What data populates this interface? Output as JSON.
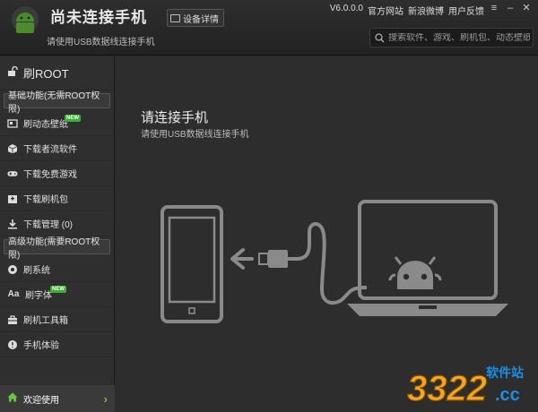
{
  "header": {
    "app_title": "尚未连接手机",
    "app_subtitle": "请使用USB数据线连接手机",
    "device_button": "设备详情",
    "version": "V6.0.0.0",
    "links": [
      "官方网站",
      "新浪微博",
      "用户反馈"
    ],
    "search_placeholder": "搜索软件、游戏、刷机包、动态壁纸"
  },
  "sidebar": {
    "root_label": "刷ROOT",
    "basic_section": "基础功能(无需ROOT权限)",
    "basic_items": [
      {
        "label": "刷动态壁纸",
        "new": "NEW",
        "icon": "wallpaper-icon"
      },
      {
        "label": "下载者流软件",
        "icon": "box-icon"
      },
      {
        "label": "下载免费游戏",
        "icon": "gamepad-icon"
      },
      {
        "label": "下载刷机包",
        "icon": "package-icon"
      },
      {
        "label": "下载管理 (0)",
        "icon": "download-icon"
      }
    ],
    "advanced_section": "高级功能(需要ROOT权限)",
    "advanced_items": [
      {
        "label": "刷系统",
        "icon": "system-icon"
      },
      {
        "label": "刷字体",
        "new": "NEW",
        "icon": "font-icon"
      },
      {
        "label": "刷机工具箱",
        "icon": "toolbox-icon"
      },
      {
        "label": "手机体验",
        "icon": "experience-icon"
      }
    ],
    "welcome": "欢迎使用"
  },
  "main": {
    "title": "请连接手机",
    "subtitle": "请使用USB数据线连接手机"
  },
  "watermark": {
    "number": "3322",
    "site": "软件站",
    "domain": ".cc"
  },
  "colors": {
    "accent_green": "#3cae34",
    "background": "#2d2d2d",
    "sidebar": "#2f2f2f",
    "illustration": "#8a8a8a"
  }
}
